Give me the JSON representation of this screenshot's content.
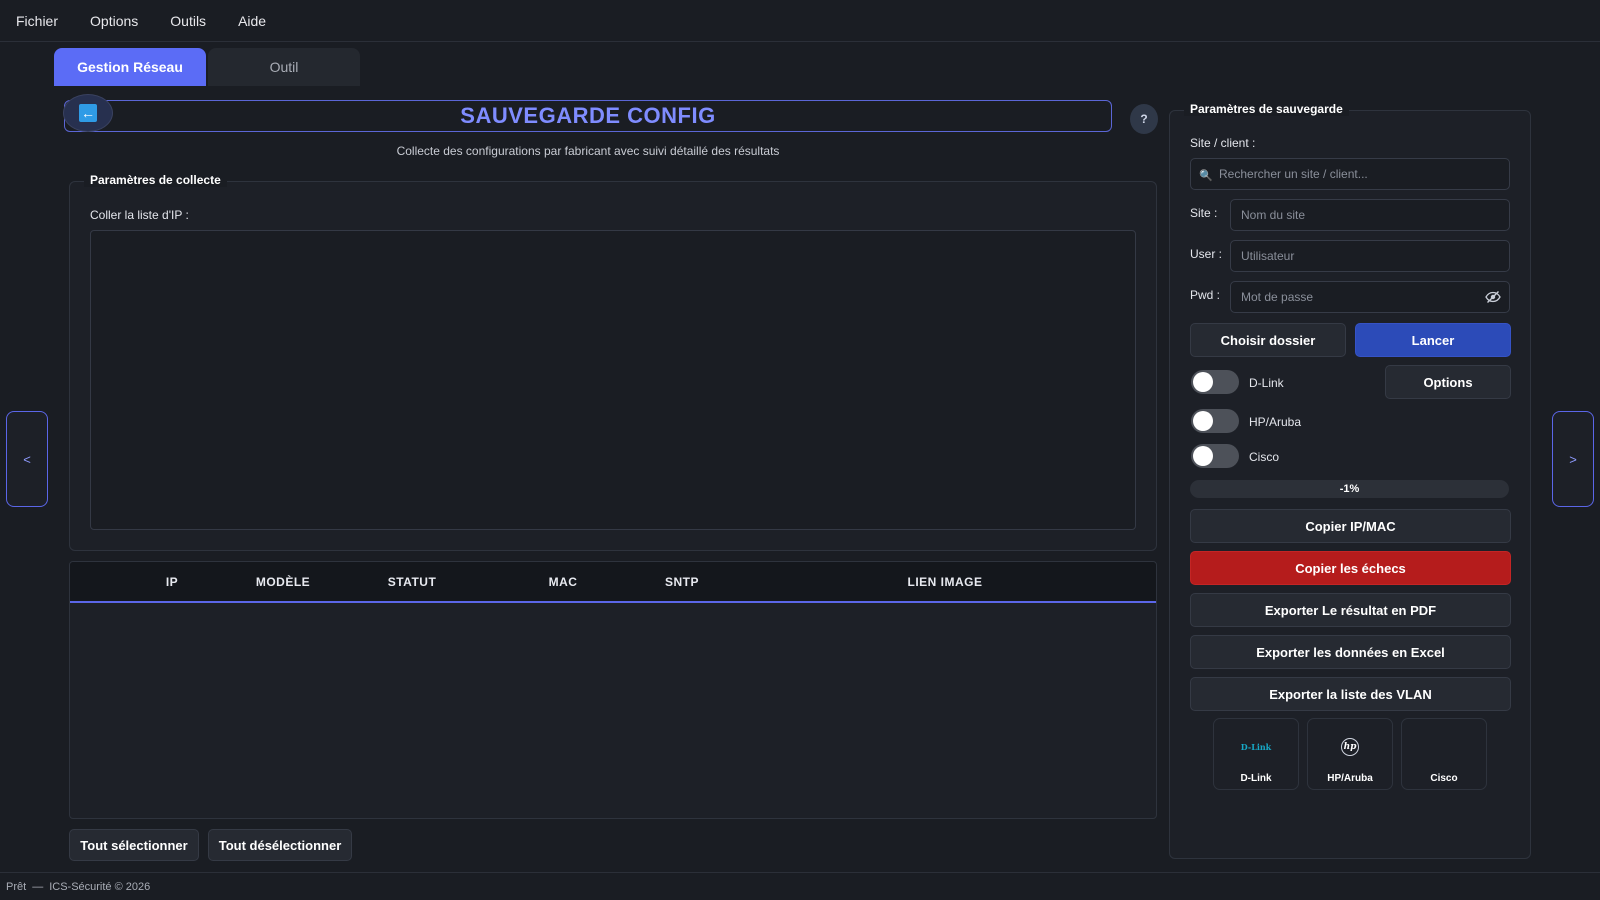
{
  "menu": {
    "items": [
      "Fichier",
      "Options",
      "Outils",
      "Aide"
    ]
  },
  "tabs": [
    {
      "label": "Gestion Réseau",
      "active": true
    },
    {
      "label": "Outil",
      "active": false
    }
  ],
  "header": {
    "title": "SAUVEGARDE CONFIG",
    "subtitle": "Collecte des configurations par fabricant avec suivi détaillé des résultats",
    "help_label": "?"
  },
  "collect": {
    "group_title": "Paramètres de collecte",
    "ip_label": "Coller la liste d'IP :",
    "ip_value": ""
  },
  "table": {
    "columns": [
      "IP",
      "MODÈLE",
      "STATUT",
      "MAC",
      "SNTP",
      "LIEN IMAGE"
    ],
    "rows": []
  },
  "selection": {
    "select_all": "Tout sélectionner",
    "deselect_all": "Tout désélectionner"
  },
  "nav": {
    "prev": "<",
    "next": ">"
  },
  "panel": {
    "group_title": "Paramètres de sauvegarde",
    "site_client_label": "Site / client :",
    "search_placeholder": "Rechercher un site / client...",
    "site_label": "Site :",
    "site_placeholder": "Nom du site",
    "user_label": "User :",
    "user_placeholder": "Utilisateur",
    "pwd_label": "Pwd :",
    "pwd_placeholder": "Mot de passe",
    "choose_folder": "Choisir dossier",
    "launch": "Lancer",
    "options": "Options",
    "toggles": [
      {
        "label": "D-Link",
        "on": false
      },
      {
        "label": "HP/Aruba",
        "on": false
      },
      {
        "label": "Cisco",
        "on": false
      }
    ],
    "progress_text": "-1%",
    "actions": {
      "copy_ip_mac": "Copier IP/MAC",
      "copy_failures": "Copier les échecs",
      "export_pdf": "Exporter Le résultat en PDF",
      "export_excel": "Exporter les données en Excel",
      "export_vlan": "Exporter la liste des VLAN"
    },
    "vendors": [
      {
        "name": "D-Link",
        "logo_text": "D-Link"
      },
      {
        "name": "HP/Aruba",
        "logo_text": "hp"
      },
      {
        "name": "Cisco",
        "logo_text": ""
      }
    ]
  },
  "status": {
    "state": "Prêt",
    "separator": "—",
    "copyright": "ICS-Sécurité © 2026"
  },
  "colors": {
    "accent": "#5b6cf6",
    "title": "#7f8cff",
    "primary_button": "#2c4bb8",
    "danger_button": "#b51c1c",
    "background": "#1a1d23"
  }
}
